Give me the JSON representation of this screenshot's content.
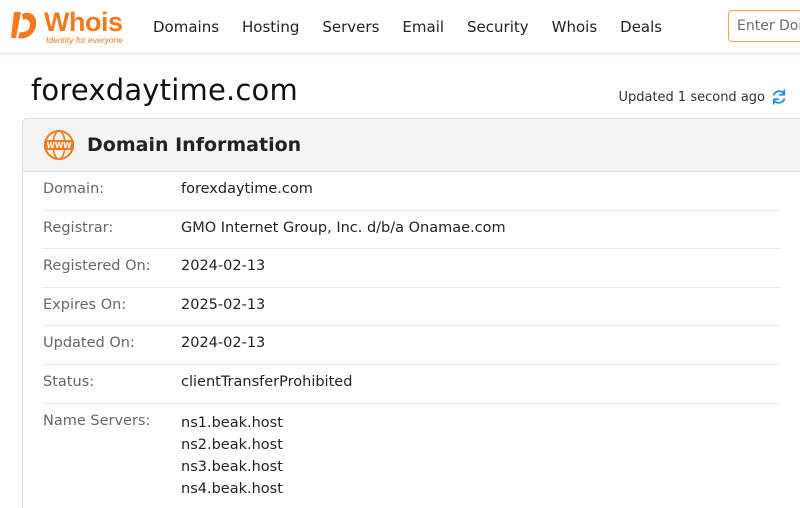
{
  "brand": {
    "name": "Whois",
    "tagline": "Identity for everyone",
    "accent_color": "#f57a1f"
  },
  "nav": {
    "items": [
      "Domains",
      "Hosting",
      "Servers",
      "Email",
      "Security",
      "Whois",
      "Deals"
    ]
  },
  "search": {
    "placeholder": "Enter Domain"
  },
  "page": {
    "title": "forexdaytime.com",
    "updated_text": "Updated 1 second ago"
  },
  "card": {
    "title": "Domain Information",
    "icon": "www-icon",
    "rows": [
      {
        "label": "Domain:",
        "value": "forexdaytime.com"
      },
      {
        "label": "Registrar:",
        "value": "GMO Internet Group, Inc. d/b/a Onamae.com"
      },
      {
        "label": "Registered On:",
        "value": "2024-02-13"
      },
      {
        "label": "Expires On:",
        "value": "2025-02-13"
      },
      {
        "label": "Updated On:",
        "value": "2024-02-13"
      },
      {
        "label": "Status:",
        "value": "clientTransferProhibited"
      }
    ],
    "name_servers_label": "Name Servers:",
    "name_servers": [
      "ns1.beak.host",
      "ns2.beak.host",
      "ns3.beak.host",
      "ns4.beak.host"
    ]
  }
}
